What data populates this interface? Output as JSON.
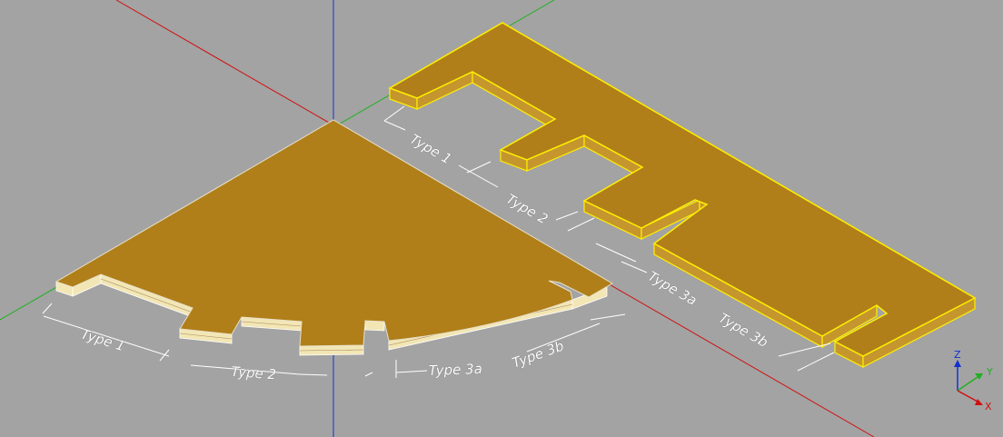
{
  "scene": {
    "background": "#a3a3a3",
    "colors": {
      "wood": "#b07f1a",
      "wood_side": "#c5962e",
      "edge_plank": "#f2e6b5",
      "selection": "#ffee00",
      "dimension": "#ffffff",
      "axis_x": "#d01010",
      "axis_y": "#20b020",
      "axis_z": "#1030d0"
    }
  },
  "left_part": {
    "labels": {
      "type1": "Type 1",
      "type2": "Type 2",
      "type3a": "Type 3a",
      "type3b": "Type 3b"
    }
  },
  "right_part": {
    "labels": {
      "type1": "Type 1",
      "type2": "Type 2",
      "type3a": "Type 3a",
      "type3b": "Type 3b"
    }
  },
  "triad": {
    "x": "X",
    "y": "Y",
    "z": "Z"
  }
}
